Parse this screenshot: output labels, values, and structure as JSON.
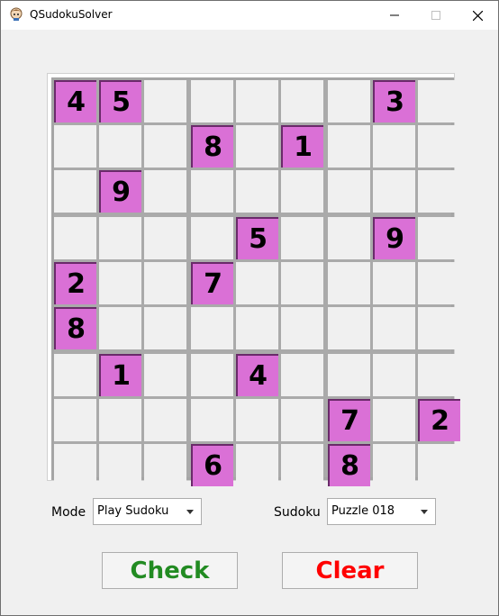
{
  "window": {
    "title": "QSudokuSolver",
    "controls": {
      "minimize": "minimize",
      "maximize": "maximize",
      "close": "close"
    }
  },
  "board": {
    "rows": [
      [
        "4",
        "5",
        "",
        "",
        "",
        "",
        "",
        "3",
        ""
      ],
      [
        "",
        "",
        "",
        "8",
        "",
        "1",
        "",
        "",
        ""
      ],
      [
        "",
        "9",
        "",
        "",
        "",
        "",
        "",
        "",
        ""
      ],
      [
        "",
        "",
        "",
        "",
        "5",
        "",
        "",
        "9",
        ""
      ],
      [
        "2",
        "",
        "",
        "7",
        "",
        "",
        "",
        "",
        ""
      ],
      [
        "8",
        "",
        "",
        "",
        "",
        "",
        "",
        "",
        ""
      ],
      [
        "",
        "1",
        "",
        "",
        "4",
        "",
        "",
        "",
        ""
      ],
      [
        "",
        "",
        "",
        "",
        "",
        "",
        "7",
        "",
        "2"
      ],
      [
        "",
        "",
        "",
        "6",
        "",
        "",
        "8",
        "",
        ""
      ]
    ],
    "given_color": "#da70d6",
    "empty_color": "#f0f0f0"
  },
  "controls": {
    "mode_label": "Mode",
    "mode_value": "Play Sudoku",
    "sudoku_label": "Sudoku",
    "sudoku_value": "Puzzle 018"
  },
  "buttons": {
    "check_label": "Check",
    "check_color": "#228b22",
    "clear_label": "Clear",
    "clear_color": "#ff0000"
  },
  "icons": {
    "app": "app-icon",
    "dropdown": "chevron-down-icon"
  }
}
